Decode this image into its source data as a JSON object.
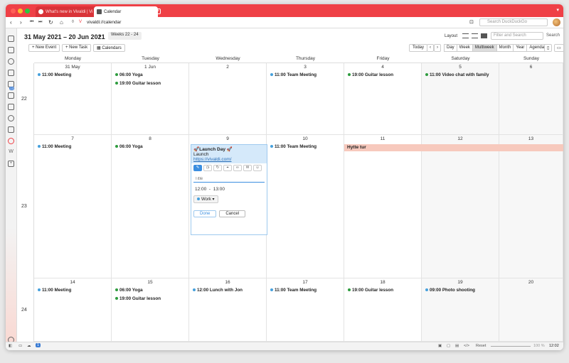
{
  "browser": {
    "tabs": [
      {
        "label": "What's new in Vivaldi | Vi"
      },
      {
        "label": "Calendar"
      }
    ],
    "address": "vivaldi://calendar",
    "search_placeholder": "Search DuckDuckGo",
    "colors": {
      "accent": "#ef4046"
    }
  },
  "header": {
    "date_range": "31 May 2021 – 20 Jun 2021",
    "weeks": "Weeks 22 - 24",
    "layout_label": "Layout",
    "filter_placeholder": "Filter and Search",
    "search_button": "Search",
    "new_event": "New Event",
    "new_task": "New Task",
    "calendars": "Calendars",
    "today": "Today",
    "views": [
      "Day",
      "Week",
      "Multiweek",
      "Month",
      "Year",
      "Agenda"
    ],
    "selected_view": "Multiweek"
  },
  "days": [
    "Monday",
    "Tuesday",
    "Wednesday",
    "Thursday",
    "Friday",
    "Saturday",
    "Sunday"
  ],
  "weeks": [
    {
      "number": "22",
      "dates": [
        "31 May",
        "1 Jun",
        "2",
        "3",
        "4",
        "5",
        "6"
      ],
      "events": [
        [
          {
            "time": "11:00",
            "title": "Meeting",
            "color": "blue"
          }
        ],
        [
          {
            "time": "06:00",
            "title": "Yoga",
            "color": "green"
          },
          {
            "time": "19:00",
            "title": "Guitar lesson",
            "color": "green"
          }
        ],
        [],
        [
          {
            "time": "11:00",
            "title": "Team Meeting",
            "color": "blue"
          }
        ],
        [
          {
            "time": "19:00",
            "title": "Guitar lesson",
            "color": "green"
          }
        ],
        [
          {
            "time": "11:00",
            "title": "Video chat with family",
            "color": "green"
          }
        ],
        []
      ]
    },
    {
      "number": "23",
      "dates": [
        "7",
        "8",
        "9",
        "10",
        "11",
        "12",
        "13"
      ],
      "events": [
        [
          {
            "time": "11:00",
            "title": "Meeting",
            "color": "blue"
          }
        ],
        [
          {
            "time": "06:00",
            "title": "Yoga",
            "color": "green"
          }
        ],
        [],
        [
          {
            "time": "11:00",
            "title": "Team Meeting",
            "color": "blue"
          }
        ],
        [],
        [],
        []
      ],
      "allday": {
        "title": "Hytte tur"
      }
    },
    {
      "number": "24",
      "dates": [
        "14",
        "15",
        "16",
        "17",
        "18",
        "19",
        "20"
      ],
      "events": [
        [
          {
            "time": "11:00",
            "title": "Meeting",
            "color": "blue"
          }
        ],
        [
          {
            "time": "06:00",
            "title": "Yoga",
            "color": "green"
          },
          {
            "time": "19:00",
            "title": "Guitar lesson",
            "color": "green"
          }
        ],
        [
          {
            "time": "12:00",
            "title": "Lunch with Jon",
            "color": "blue"
          }
        ],
        [
          {
            "time": "11:00",
            "title": "Team Meeting",
            "color": "blue"
          }
        ],
        [
          {
            "time": "19:00",
            "title": "Guitar lesson",
            "color": "green"
          }
        ],
        [
          {
            "time": "09:00",
            "title": "Photo shooting",
            "color": "blue"
          }
        ],
        []
      ]
    }
  ],
  "editor": {
    "title": "🚀Launch Day 🚀",
    "subtitle": "Launch",
    "link": "https://vivaldi.com/",
    "title_placeholder": "Title",
    "start": "12:00",
    "separator": "-",
    "end": "13:00",
    "calendar": "Work",
    "done": "Done",
    "cancel": "Cancel"
  },
  "status": {
    "reset": "Reset",
    "zoom": "100 %",
    "clock": "12:02",
    "badge": "1"
  }
}
